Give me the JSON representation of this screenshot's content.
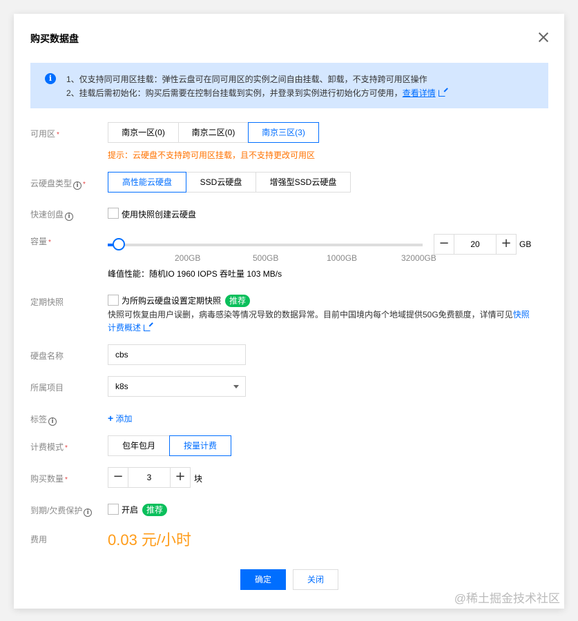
{
  "dialog": {
    "title": "购买数据盘"
  },
  "notice": {
    "line1": "1、仅支持同可用区挂载：弹性云盘可在同可用区的实例之间自由挂载、卸载，不支持跨可用区操作",
    "line2_prefix": "2、挂载后需初始化：购买后需要在控制台挂载到实例，并登录到实例进行初始化方可使用，",
    "line2_link": "查看详情",
    "icon": "info-icon"
  },
  "zone": {
    "label": "可用区",
    "options": [
      "南京一区(0)",
      "南京二区(0)",
      "南京三区(3)"
    ],
    "selected": "南京三区(3)",
    "hint": "提示：云硬盘不支持跨可用区挂载，且不支持更改可用区"
  },
  "disk_type": {
    "label": "云硬盘类型",
    "options": [
      "高性能云硬盘",
      "SSD云硬盘",
      "增强型SSD云硬盘"
    ],
    "selected": "高性能云硬盘"
  },
  "snapshot_create": {
    "label": "快速创盘",
    "checkbox_label": "使用快照创建云硬盘",
    "checked": false
  },
  "capacity": {
    "label": "容量",
    "value": "20",
    "unit": "GB",
    "ticks": [
      "200GB",
      "500GB",
      "1000GB",
      "32000GB"
    ],
    "slider_fraction": 0.035,
    "performance": "峰值性能：随机IO 1960 IOPS 吞吐量 103 MB/s"
  },
  "scheduled_snapshot": {
    "label": "定期快照",
    "checkbox_label": "为所购云硬盘设置定期快照",
    "badge": "推荐",
    "desc_prefix": "快照可恢复由用户误删，病毒感染等情况导致的数据异常。目前中国境内每个地域提供50G免费额度，详情可见",
    "desc_link": "快照计费概述",
    "checked": false
  },
  "disk_name": {
    "label": "硬盘名称",
    "value": "cbs"
  },
  "project": {
    "label": "所属项目",
    "value": "k8s"
  },
  "tags": {
    "label": "标签",
    "add_label": "添加"
  },
  "billing": {
    "label": "计费模式",
    "options": [
      "包年包月",
      "按量计费"
    ],
    "selected": "按量计费"
  },
  "quantity": {
    "label": "购买数量",
    "value": "3",
    "unit": "块"
  },
  "protection": {
    "label": "到期/欠费保护",
    "checkbox_label": "开启",
    "badge": "推荐",
    "checked": false
  },
  "cost": {
    "label": "费用",
    "price": "0.03 元/小时"
  },
  "footer": {
    "confirm": "确定",
    "close": "关闭"
  },
  "watermark": "@稀土掘金技术社区",
  "colors": {
    "primary": "#006eff",
    "warning": "#ff7200",
    "price": "#ff9c19",
    "badge": "#0abf5b",
    "notice_bg": "#d5e7ff"
  }
}
